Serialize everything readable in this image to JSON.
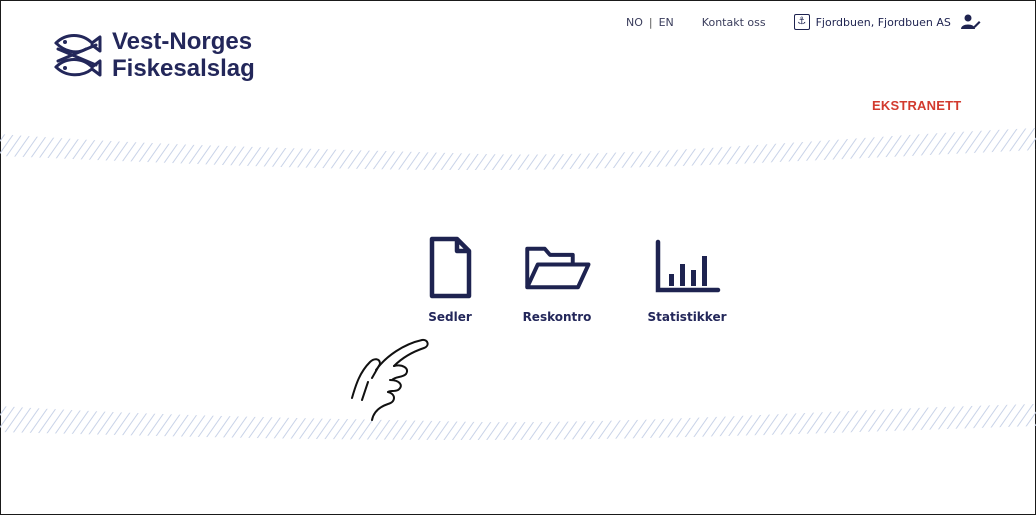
{
  "brand": {
    "line1": "Vest-Norges",
    "line2": "Fiskesalslag"
  },
  "topnav": {
    "lang_no": "NO",
    "lang_sep": "|",
    "lang_en": "EN",
    "contact": "Kontakt oss",
    "user_name": "Fjordbuen, Fjordbuen AS"
  },
  "section_label": "EKSTRANETT",
  "tiles": [
    {
      "label": "Sedler",
      "icon": "document-icon"
    },
    {
      "label": "Reskontro",
      "icon": "folder-open-icon"
    },
    {
      "label": "Statistikker",
      "icon": "bar-chart-icon"
    }
  ],
  "colors": {
    "brand_navy": "#23275a",
    "accent_red": "#d23a2e",
    "wave_blue": "#c9d3e8"
  }
}
